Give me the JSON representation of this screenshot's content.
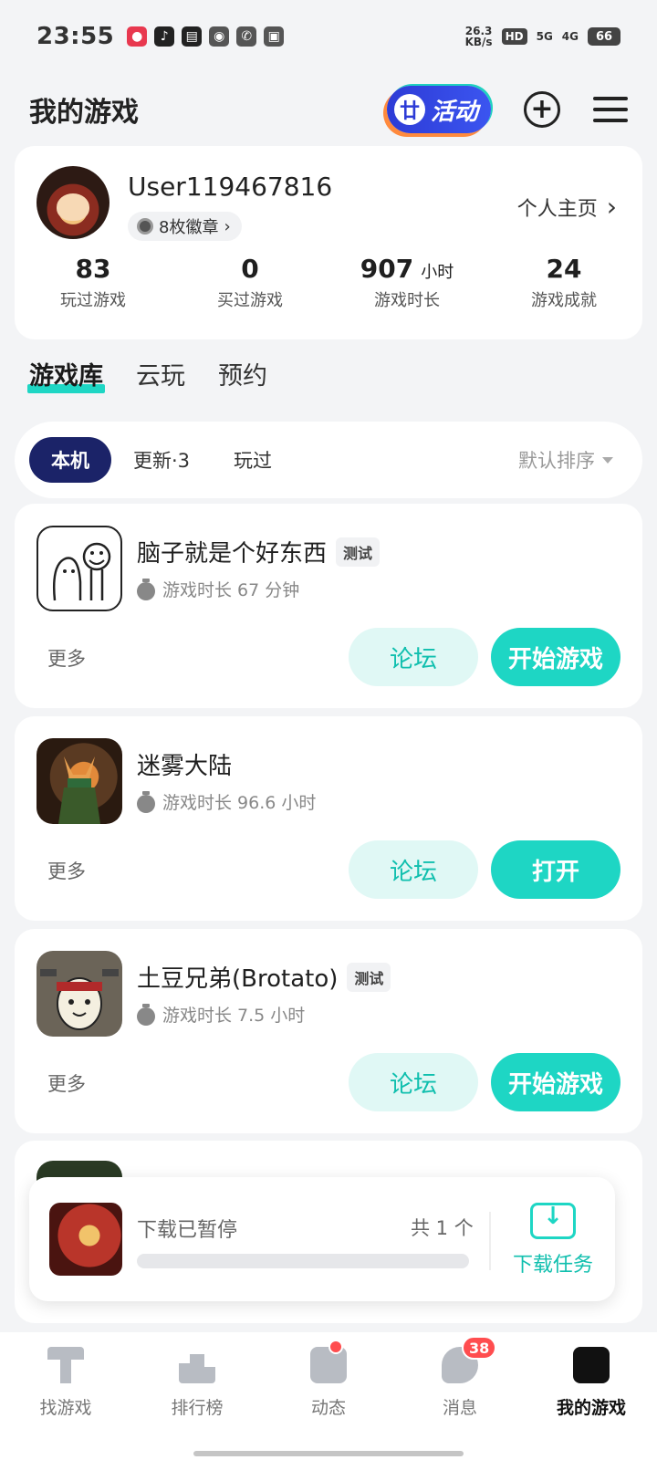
{
  "status_bar": {
    "time": "23:55",
    "net_speed_value": "26.3",
    "net_speed_unit": "KB/s",
    "hd": "HD",
    "sig1": "5G",
    "sig2": "4G",
    "battery": "66"
  },
  "header": {
    "title": "我的游戏",
    "activity_label": "活动"
  },
  "profile": {
    "username": "User119467816",
    "badges": "8枚徽章",
    "home_link": "个人主页",
    "stats": [
      {
        "value": "83",
        "unit": "",
        "label": "玩过游戏"
      },
      {
        "value": "0",
        "unit": "",
        "label": "买过游戏"
      },
      {
        "value": "907",
        "unit": "小时",
        "label": "游戏时长"
      },
      {
        "value": "24",
        "unit": "",
        "label": "游戏成就"
      }
    ]
  },
  "main_tabs": [
    "游戏库",
    "云玩",
    "预约"
  ],
  "filters": {
    "chips": [
      "本机",
      "更新·3",
      "玩过"
    ],
    "sort": "默认排序"
  },
  "games": [
    {
      "name": "脑子就是个好东西",
      "tag": "测试",
      "playtime": "游戏时长 67 分钟",
      "more": "更多",
      "forum": "论坛",
      "action": "开始游戏"
    },
    {
      "name": "迷雾大陆",
      "tag": "",
      "playtime": "游戏时长 96.6 小时",
      "more": "更多",
      "forum": "论坛",
      "action": "打开"
    },
    {
      "name": "土豆兄弟(Brotato)",
      "tag": "测试",
      "playtime": "游戏时长 7.5 小时",
      "more": "更多",
      "forum": "论坛",
      "action": "开始游戏"
    }
  ],
  "download": {
    "status": "下载已暂停",
    "count": "共 1 个",
    "progress": 0,
    "task_label": "下载任务"
  },
  "bottom_nav": [
    {
      "label": "找游戏",
      "icon": "find-game-icon"
    },
    {
      "label": "排行榜",
      "icon": "ranking-icon"
    },
    {
      "label": "动态",
      "icon": "feed-icon"
    },
    {
      "label": "消息",
      "icon": "message-icon",
      "badge": "38"
    },
    {
      "label": "我的游戏",
      "icon": "my-games-icon"
    }
  ]
}
